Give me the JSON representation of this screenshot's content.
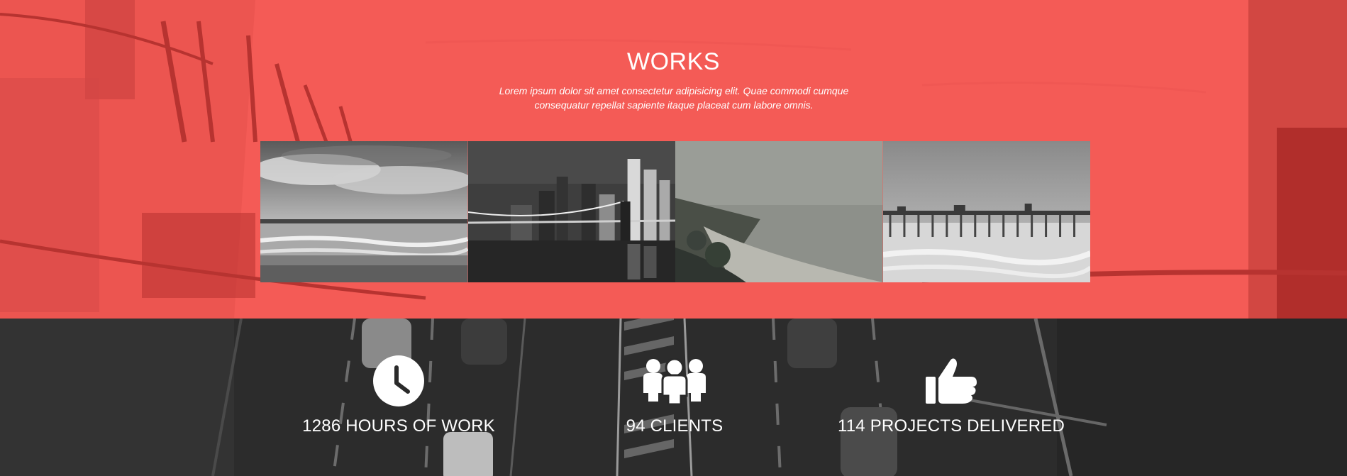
{
  "works": {
    "title": "WORKS",
    "subtitle": "Lorem ipsum dolor sit amet consectetur adipisicing elit. Quae commodi cumque consequatur repellat sapiente itaque placeat cum labore omnis.",
    "accent_color": "#f35a55",
    "gallery": [
      {
        "subject": "cloudy-beach-photo"
      },
      {
        "subject": "bridge-city-night-photo"
      },
      {
        "subject": "foggy-coast-photo"
      },
      {
        "subject": "pier-photo"
      }
    ]
  },
  "stats": {
    "items": [
      {
        "icon": "clock-icon",
        "label": "1286 HOURS OF WORK"
      },
      {
        "icon": "people-icon",
        "label": "94 CLIENTS"
      },
      {
        "icon": "thumbs-up-icon",
        "label": "114 PROJECTS DELIVERED"
      }
    ]
  }
}
